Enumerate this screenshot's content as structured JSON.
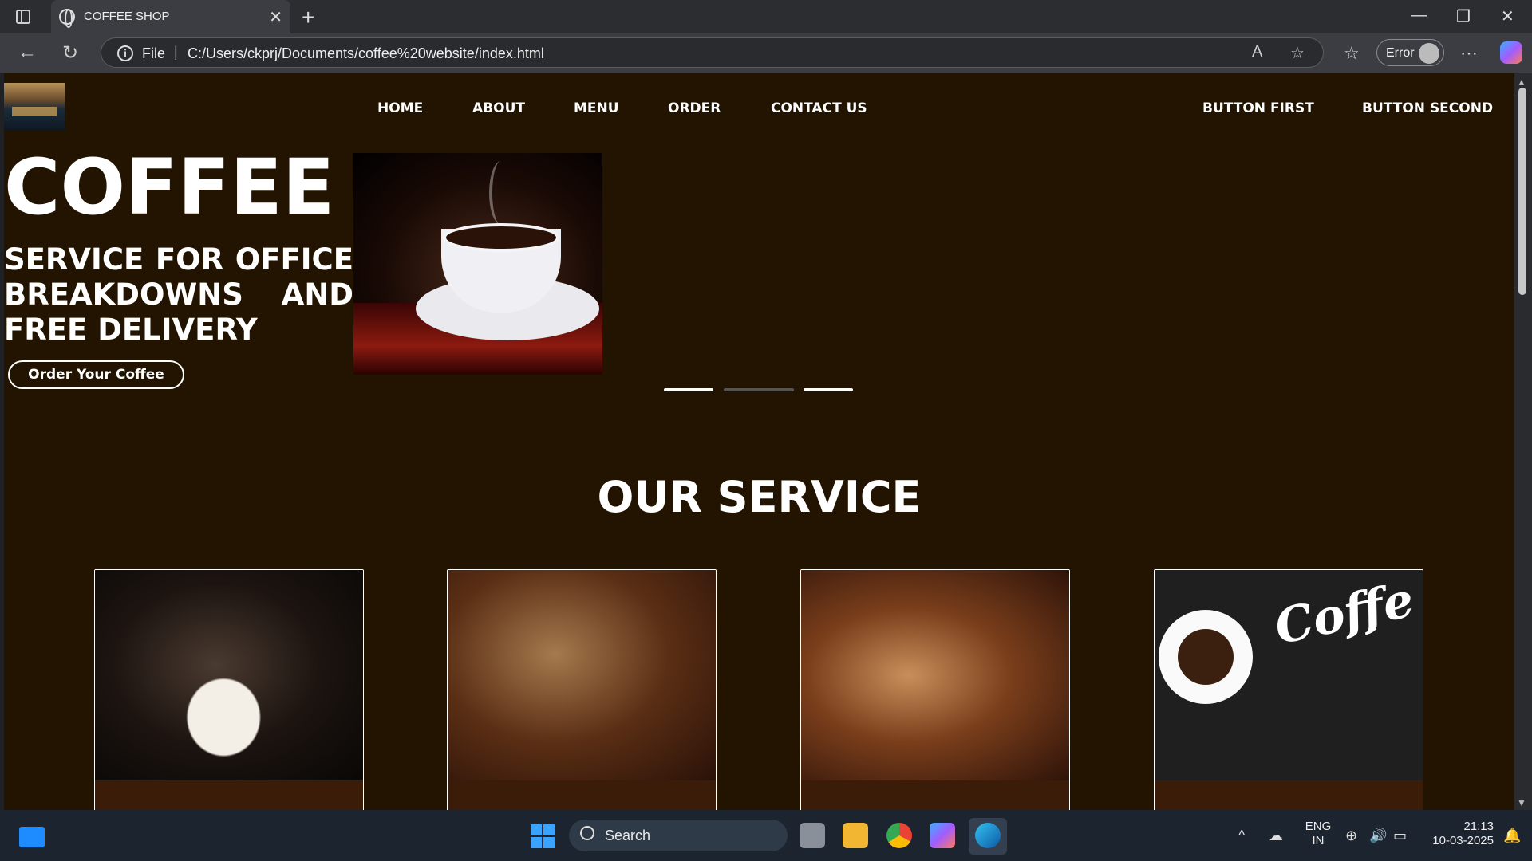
{
  "browser": {
    "tab_title": "COFFEE SHOP",
    "address_scheme": "File",
    "address_url": "C:/Users/ckprj/Documents/coffee%20website/index.html",
    "profile_label": "Error"
  },
  "site": {
    "nav": [
      "HOME",
      "ABOUT",
      "MENU",
      "ORDER",
      "CONTACT US"
    ],
    "buttons": [
      "BUTTON FIRST",
      "BUTTON SECOND"
    ],
    "hero": {
      "title": "COFFEE",
      "subtitle": "SERVICE FOR OFFICE BREAKDOWNS AND FREE DELIVERY",
      "cta": "Order Your Coffee"
    },
    "slider": {
      "count": 3,
      "active": 2
    },
    "section_title": "OUR SERVICE"
  },
  "taskbar": {
    "search_label": "Search",
    "lang_top": "ENG",
    "lang_bottom": "IN",
    "time": "21:13",
    "date": "10-03-2025"
  },
  "colors": {
    "page_bg": "#221400",
    "card_footer": "#3a1c08",
    "accent": "#ffffff"
  }
}
